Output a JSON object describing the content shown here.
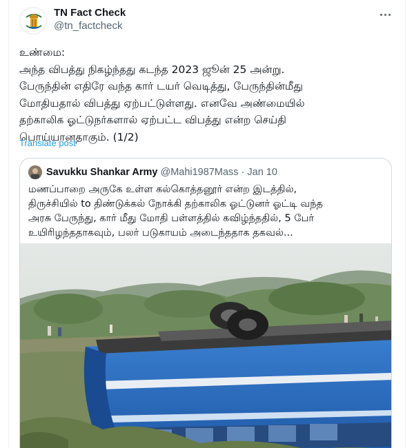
{
  "author": {
    "display_name": "TN Fact Check",
    "handle": "@tn_factcheck",
    "avatar_icon": "tn-emblem-icon"
  },
  "more_icon": "more-horizontal-icon",
  "tweet": {
    "lines": [
      "உண்மை:",
      "அந்த விபத்து நிகழ்ந்தது கடந்த 2023 ஜூன் 25 அன்று.",
      "பேருந்தின் எதிரே வந்த கார் டயர் வெடித்து, பேருந்தின்மீது",
      "மோதியதால் விபத்து ஏற்பட்டுள்ளது. எனவே அண்மையில்",
      "தற்காலிக ஓட்டுநர்களால் ஏற்பட்ட விபத்து என்ற செய்தி",
      "பொய்யானதாகும். (1/2)"
    ],
    "translate_label": "Translate post"
  },
  "quote": {
    "display_name": "Savukku Shankar Army",
    "handle": "@Mahi1987Mass",
    "separator": "·",
    "date": "Jan 10",
    "lines": [
      "மணப்பாறை அருகே உள்ள கல்கொத்தனூர் என்ற இடத்தில்,",
      "திருச்சியில் to திண்டுக்கல் நோக்கி தற்காலிக ஓட்டுனர் ஓட்டி வந்த",
      "அரசு பேருந்து, கார் மீது மோதி பள்ளத்தில் கவிழ்ந்ததில், 5 பேர்",
      "உயிரிழந்ததாகவும், பலர் படுகாயம் அடைந்ததாக தகவல்..."
    ],
    "media_subject": "overturned-blue-bus-photo"
  },
  "colors": {
    "link": "#1d9bf0",
    "secondary_text": "#536471",
    "border": "#cfd9de",
    "bus_blue": "#2f6fc0"
  }
}
